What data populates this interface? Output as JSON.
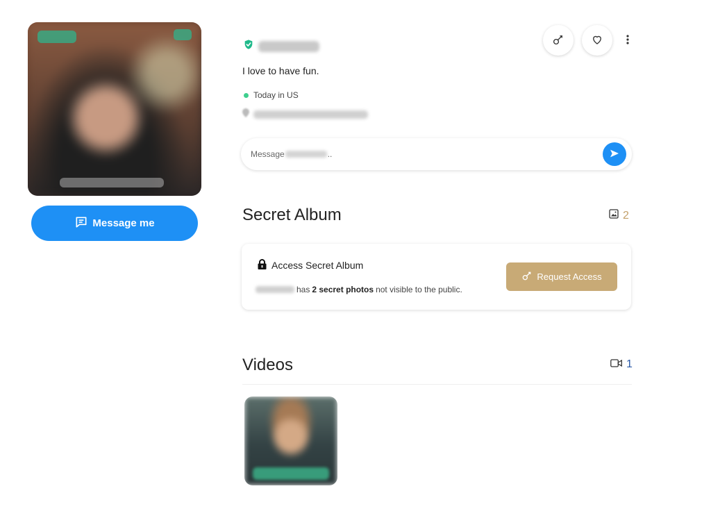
{
  "profile": {
    "bio": "I love to have fun.",
    "status": "Today in US",
    "message_button": "Message me",
    "message_placeholder_prefix": "Message",
    "message_placeholder_suffix": ".."
  },
  "secret_album": {
    "title": "Secret Album",
    "count": "2",
    "card_title": "Access Secret Album",
    "desc_has": "has",
    "desc_bold": "2 secret photos",
    "desc_rest": "not visible to the public.",
    "request_button": "Request Access"
  },
  "videos": {
    "title": "Videos",
    "count": "1"
  },
  "icons": {
    "verified": "shield-check-icon",
    "key": "key-icon",
    "heart": "heart-icon",
    "more": "more-vertical-icon",
    "send": "send-icon",
    "image": "image-icon",
    "video": "video-camera-icon",
    "lock": "lock-icon",
    "message": "message-square-icon",
    "location": "location-pin-icon"
  },
  "colors": {
    "primary_blue": "#1e90f5",
    "gold": "#c8aa76",
    "online_green": "#3ecf8e",
    "verified_green": "#1fb98a"
  }
}
